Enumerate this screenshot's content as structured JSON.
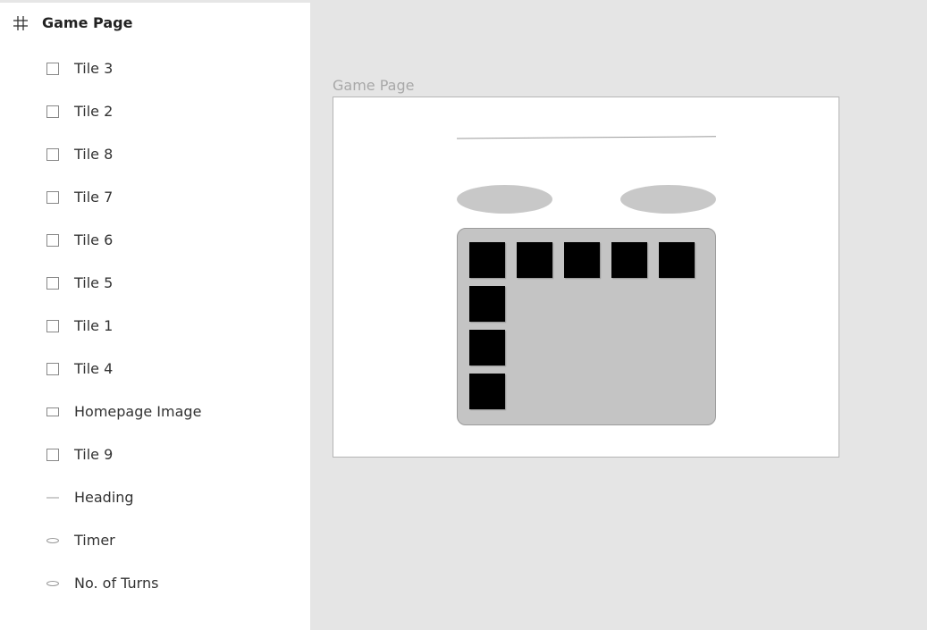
{
  "layers": {
    "frame": {
      "icon": "frame-hash-icon",
      "label": "Game Page"
    },
    "items": [
      {
        "label": "Tile 3",
        "icon": "rectangle-icon"
      },
      {
        "label": "Tile 2",
        "icon": "rectangle-icon"
      },
      {
        "label": "Tile 8",
        "icon": "rectangle-icon"
      },
      {
        "label": "Tile 7",
        "icon": "rectangle-icon"
      },
      {
        "label": "Tile 6",
        "icon": "rectangle-icon"
      },
      {
        "label": "Tile 5",
        "icon": "rectangle-icon"
      },
      {
        "label": "Tile 1",
        "icon": "rectangle-icon"
      },
      {
        "label": "Tile 4",
        "icon": "rectangle-icon"
      },
      {
        "label": "Homepage Image",
        "icon": "image-rectangle-icon"
      },
      {
        "label": "Tile 9",
        "icon": "rectangle-icon"
      },
      {
        "label": "Heading",
        "icon": "line-icon"
      },
      {
        "label": "Timer",
        "icon": "ellipse-icon"
      },
      {
        "label": "No. of Turns",
        "icon": "ellipse-icon"
      }
    ]
  },
  "canvas": {
    "frame_title": "Game Page"
  },
  "colors": {
    "panel_bg": "#ffffff",
    "canvas_bg": "#e5e5e5",
    "frame_bg": "#ffffff",
    "shape_gray": "#c8c8c8",
    "board_gray": "#c4c4c4",
    "tile_black": "#000000",
    "icon_gray": "#888888"
  }
}
